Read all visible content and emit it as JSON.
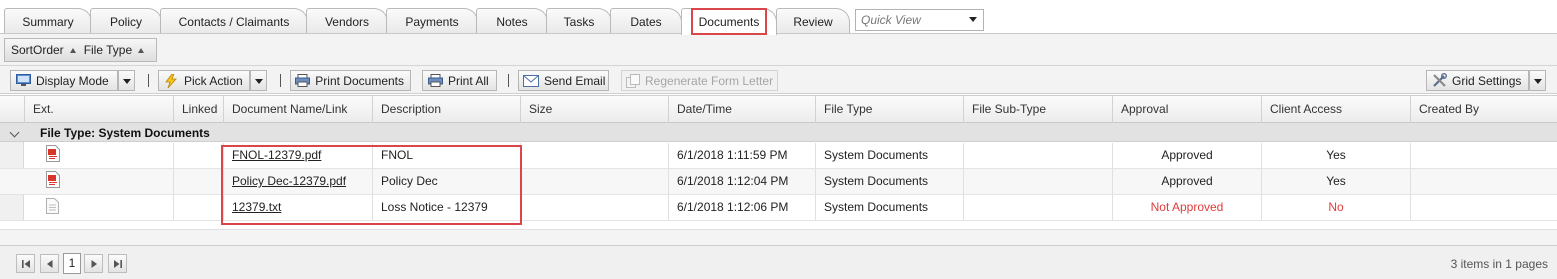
{
  "tabs": [
    {
      "label": "Summary"
    },
    {
      "label": "Policy"
    },
    {
      "label": "Contacts / Claimants"
    },
    {
      "label": "Vendors"
    },
    {
      "label": "Payments"
    },
    {
      "label": "Notes"
    },
    {
      "label": "Tasks"
    },
    {
      "label": "Dates"
    },
    {
      "label": "Documents",
      "active": true
    },
    {
      "label": "Review"
    }
  ],
  "quick_view": {
    "placeholder": "Quick View"
  },
  "group_panel": {
    "sort1": "SortOrder",
    "sort2": "File Type"
  },
  "toolbar": {
    "display_mode": "Display Mode",
    "pick_action": "Pick Action",
    "print_documents": "Print Documents",
    "print_all": "Print All",
    "send_email": "Send Email",
    "regenerate": "Regenerate Form Letter",
    "grid_settings": "Grid Settings"
  },
  "grid": {
    "columns": [
      "Ext.",
      "Linked",
      "Document Name/Link",
      "Description",
      "Size",
      "Date/Time",
      "File Type",
      "File Sub-Type",
      "Approval",
      "Client Access",
      "Created By"
    ],
    "group_label": "File Type: System Documents",
    "rows": [
      {
        "ext": "pdf-icon",
        "name": "FNOL-12379.pdf",
        "description": "FNOL",
        "size": "",
        "datetime": "6/1/2018 1:11:59 PM",
        "file_type": "System Documents",
        "sub_type": "",
        "approval": "Approved",
        "client_access": "Yes"
      },
      {
        "ext": "pdf-icon",
        "name": "Policy Dec-12379.pdf",
        "description": "Policy Dec",
        "size": "",
        "datetime": "6/1/2018 1:12:04 PM",
        "file_type": "System Documents",
        "sub_type": "",
        "approval": "Approved",
        "client_access": "Yes"
      },
      {
        "ext": "text-file-icon",
        "name": "12379.txt",
        "description": "Loss Notice - 12379",
        "size": "",
        "datetime": "6/1/2018 1:12:06 PM",
        "file_type": "System Documents",
        "sub_type": "",
        "approval": "Not Approved",
        "client_access": "No"
      }
    ]
  },
  "pager": {
    "current_page": "1",
    "info": "3 items in 1 pages"
  },
  "colors": {
    "highlight": "#d9474a",
    "negative": "#e03c3c"
  }
}
